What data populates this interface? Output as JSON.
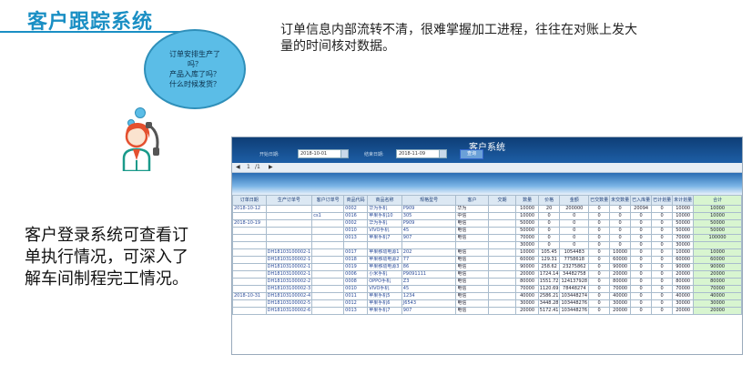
{
  "slide": {
    "title": "客户跟踪系统",
    "intro_text": "订单信息内部流转不清，很难掌握加工进程，往往在对账上发大量的时间核对数据。",
    "bubble_lines": [
      "订单安排生产了",
      "吗？",
      "产品入库了吗？",
      "什么时候发货？"
    ],
    "bottom_text": "客户登录系统可查看订单执行情况，可深入了解车间制程完工情况。",
    "accent_color": "#1a8fc4"
  },
  "system": {
    "title": "客户系统",
    "start_label": "开始日期:",
    "start_date": "2018-10-01",
    "end_label": "结束日期:",
    "end_date": "2018-11-09",
    "query_label": "查询",
    "pager": {
      "prev": "◀",
      "page": "1",
      "sep": "/1",
      "next": "▶"
    },
    "columns": [
      "订单日期",
      "生产订单号",
      "客户订单号",
      "商品代码",
      "商品名称",
      "规格型号",
      "客户",
      "交期",
      "数量",
      "价格",
      "金额",
      "已交数量",
      "未交数量",
      "已入库量",
      "已计划量",
      "未计划量",
      "合计"
    ],
    "rows": [
      [
        "2018-10-12",
        "",
        "",
        "0002",
        "华为手机",
        "P909",
        "华为",
        "",
        "10000",
        "20",
        "200000",
        "0",
        "0",
        "20094",
        "0",
        "10000",
        "10000"
      ],
      [
        "",
        "",
        "cs1",
        "0016",
        "苹果手机10",
        "305",
        "中信",
        "",
        "10000",
        "0",
        "0",
        "0",
        "0",
        "0",
        "0",
        "10000",
        "10000"
      ],
      [
        "2018-10-19",
        "",
        "",
        "0002",
        "华为手机",
        "P909",
        "电信",
        "",
        "50000",
        "0",
        "0",
        "0",
        "0",
        "0",
        "0",
        "50000",
        "50000"
      ],
      [
        "",
        "",
        "",
        "0010",
        "VIVO手机",
        "45",
        "电信",
        "",
        "50000",
        "0",
        "0",
        "0",
        "0",
        "0",
        "0",
        "50000",
        "50000"
      ],
      [
        "",
        "",
        "",
        "0013",
        "苹果手机7",
        "907",
        "电信",
        "",
        "70000",
        "0",
        "0",
        "0",
        "0",
        "0",
        "0",
        "70000",
        "100000"
      ],
      [
        "",
        "",
        "",
        "",
        "",
        "",
        "",
        "",
        "30000",
        "0",
        "0",
        "0",
        "0",
        "0",
        "0",
        "30000",
        ""
      ],
      [
        "",
        "DH18103100002-1",
        "",
        "0017",
        "苹果移动电源1",
        "202",
        "电信",
        "",
        "10000",
        "105.45",
        "1054483",
        "0",
        "10000",
        "0",
        "0",
        "10000",
        "10000"
      ],
      [
        "",
        "DH18103100002-1",
        "",
        "0018",
        "苹果移动电源2",
        "77",
        "电信",
        "",
        "60000",
        "129.31",
        "7758618",
        "0",
        "60000",
        "0",
        "0",
        "60000",
        "60000"
      ],
      [
        "",
        "DH18103100002-1",
        "",
        "0019",
        "苹果移动电源3",
        "86",
        "电信",
        "",
        "90000",
        "258.62",
        "23275862",
        "0",
        "90000",
        "0",
        "0",
        "90000",
        "90000"
      ],
      [
        "",
        "DH18103100002-1",
        "",
        "0006",
        "小米手机",
        "P9091111",
        "电信",
        "",
        "20000",
        "1724.14",
        "34482758",
        "0",
        "20000",
        "0",
        "0",
        "20000",
        "20000"
      ],
      [
        "",
        "DH18103100002-2",
        "",
        "0008",
        "OPPO手机",
        "Z3",
        "电信",
        "",
        "80000",
        "1551.72",
        "124137928",
        "0",
        "80000",
        "0",
        "0",
        "80000",
        "80000"
      ],
      [
        "",
        "DH18103100002-3",
        "",
        "0010",
        "VIVO手机",
        "45",
        "电信",
        "",
        "70000",
        "1120.69",
        "78448274",
        "0",
        "70000",
        "0",
        "0",
        "70000",
        "70000"
      ],
      [
        "2018-10-31",
        "DH18103100002-4",
        "",
        "0011",
        "苹果手机5",
        "1234",
        "电信",
        "",
        "40000",
        "2586.21",
        "103448274",
        "0",
        "40000",
        "0",
        "0",
        "40000",
        "40000"
      ],
      [
        "",
        "DH18103100002-5",
        "",
        "0012",
        "苹果手机6",
        "J6543",
        "电信",
        "",
        "30000",
        "3448.28",
        "103448276",
        "0",
        "30000",
        "0",
        "0",
        "30000",
        "30000"
      ],
      [
        "",
        "DH18103100002-6",
        "",
        "0013",
        "苹果手机7",
        "907",
        "电信",
        "",
        "20000",
        "5172.41",
        "103448276",
        "0",
        "20000",
        "0",
        "0",
        "20000",
        "20000"
      ]
    ]
  }
}
